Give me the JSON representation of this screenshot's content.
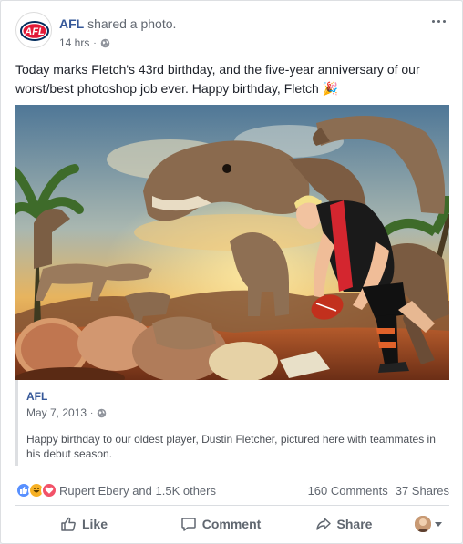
{
  "post": {
    "page_name": "AFL",
    "action": "shared a photo.",
    "time": "14 hrs",
    "status_text": "Today marks Fletch's 43rd birthday, and the five-year anniversary of our worst/best photoshop job ever. Happy birthday, Fletch 🎉",
    "logo_text": "AFL"
  },
  "shared": {
    "name": "AFL",
    "date": "May 7, 2013",
    "text": "Happy birthday to our oldest player, Dustin Fletcher, pictured here with teammates in his debut season."
  },
  "stats": {
    "reactors": "Rupert Ebery and 1.5K others",
    "comments": "160 Comments",
    "shares": "37 Shares"
  },
  "actions": {
    "like": "Like",
    "comment": "Comment",
    "share": "Share"
  },
  "colors": {
    "link": "#365899",
    "like": "#5890ff",
    "haha": "#f7b125",
    "love": "#f25268",
    "afl_navy": "#002b5c",
    "afl_red": "#e21937"
  },
  "icons": [
    "globe-icon",
    "more-icon",
    "like-icon",
    "comment-icon",
    "share-icon",
    "chevron-down-icon"
  ]
}
